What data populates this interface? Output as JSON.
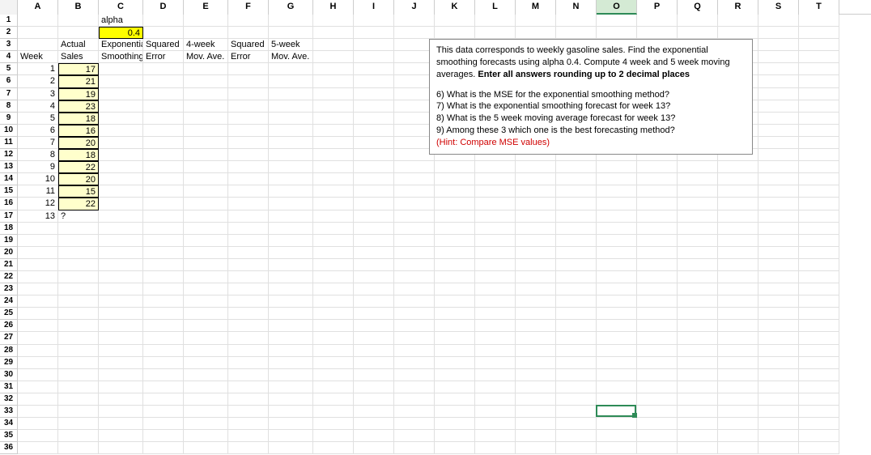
{
  "columns": [
    "A",
    "B",
    "C",
    "D",
    "E",
    "F",
    "G",
    "H",
    "I",
    "J",
    "K",
    "L",
    "M",
    "N",
    "O",
    "P",
    "Q",
    "R",
    "S",
    "T"
  ],
  "rows_count": 36,
  "selected_column": "O",
  "active_cell": {
    "col": "O",
    "row": 33
  },
  "labels": {
    "alpha": "alpha",
    "alpha_value": "0.4",
    "week": "Week",
    "actual": "Actual",
    "sales": "Sales",
    "exp": "Exponentia",
    "smoothing": "Smoothing",
    "squared": "Squared",
    "error": "Error",
    "fourwk": "4-week",
    "movave": "Mov. Ave.",
    "fivewk": "5-week",
    "week13q": "?"
  },
  "data": {
    "weeks": [
      1,
      2,
      3,
      4,
      5,
      6,
      7,
      8,
      9,
      10,
      11,
      12,
      13
    ],
    "sales": [
      17,
      21,
      19,
      23,
      18,
      16,
      20,
      18,
      22,
      20,
      15,
      22
    ]
  },
  "instructions": {
    "intro1": "This data corresponds to weekly gasoline sales. Find the exponential smoothing forecasts using alpha 0.4. Compute  4 week and 5 week moving averages. ",
    "intro_bold": "Enter all answers rounding up to 2 decimal places",
    "q6": "6) What is the MSE for the exponential smoothing method?",
    "q7": "7) What is the exponential smoothing forecast for week 13?",
    "q8": "8) What is the 5 week moving average forecast for week 13?",
    "q9": "9) Among these 3 which one is the best forecasting method?",
    "hint": "(Hint: Compare MSE values)"
  }
}
